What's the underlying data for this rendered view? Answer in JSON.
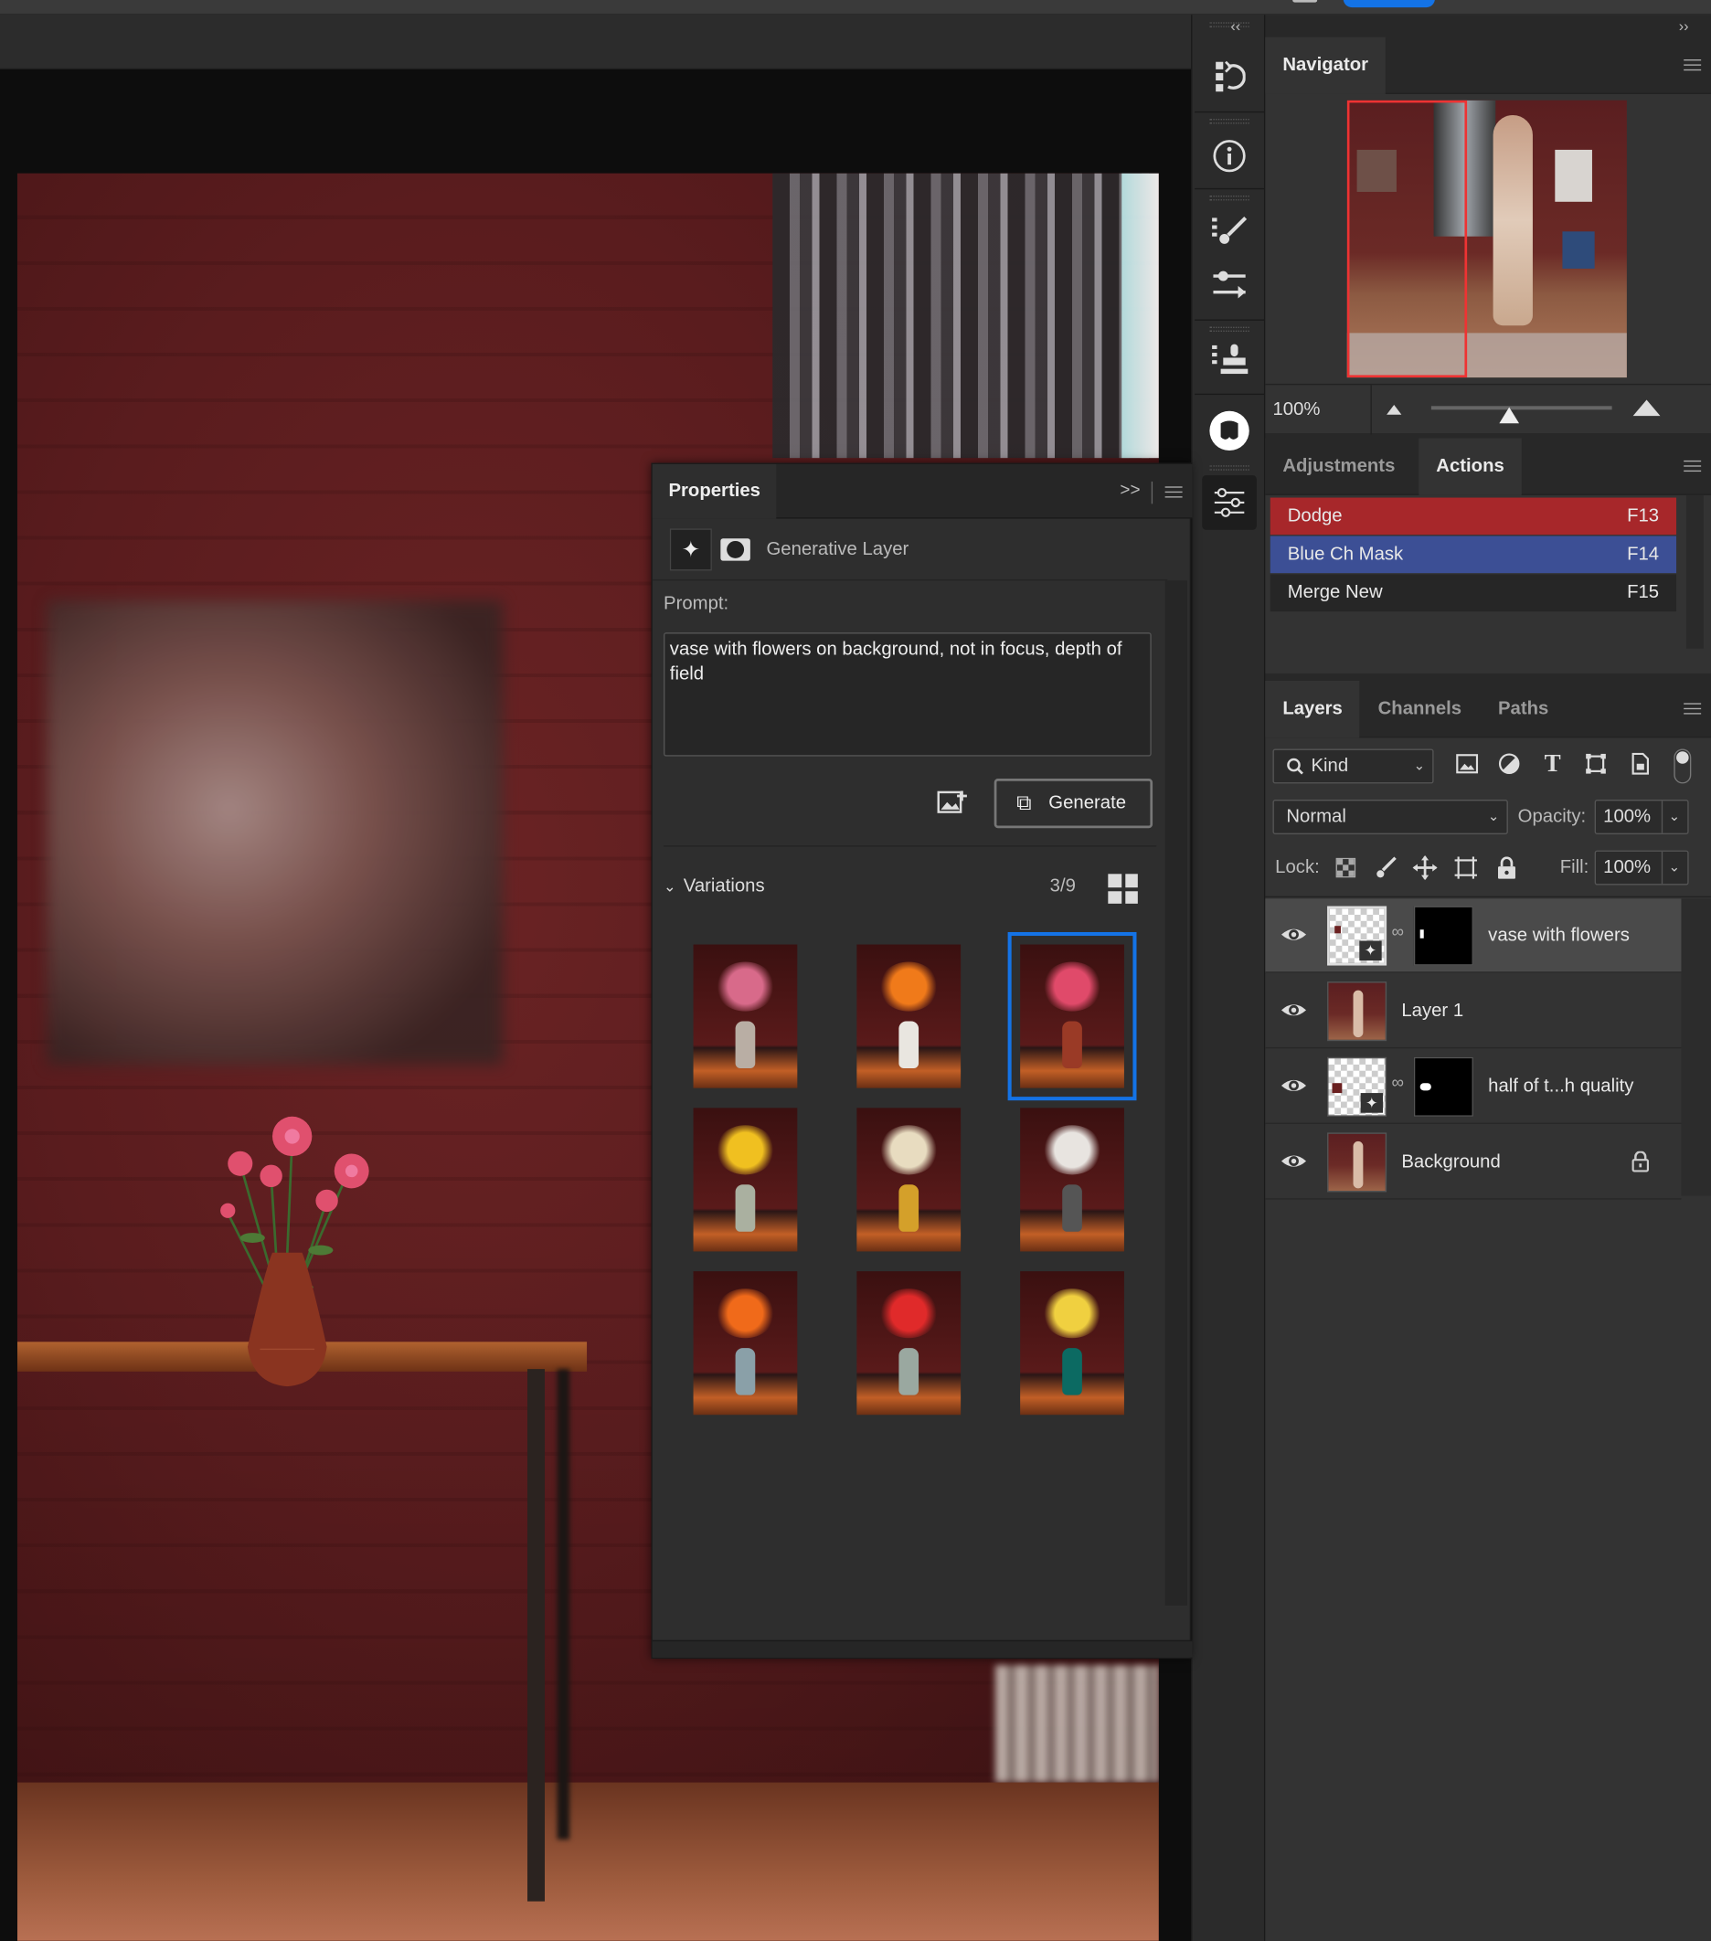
{
  "colors": {
    "accent": "#1473e6",
    "action_dodge": "#a7272a",
    "action_blue": "#3c4f95",
    "panel_bg": "#333333"
  },
  "icons": {
    "collapse_left": "‹‹",
    "collapse_right": "››",
    "toolstrip": [
      "history-icon",
      "info-icon",
      "brush-presets-icon",
      "adjust-presets-icon",
      "clone-source-icon",
      "libraries-icon",
      "adjustment-sliders-icon"
    ]
  },
  "navigator": {
    "title": "Navigator",
    "zoom": "100%",
    "zoom_slider_fraction": 0.43
  },
  "adjustments_panel": {
    "tabs": [
      "Adjustments",
      "Actions"
    ],
    "active_tab": "Actions",
    "actions": [
      {
        "name": "Dodge",
        "key": "F13",
        "color": "#a7272a"
      },
      {
        "name": "Blue Ch Mask",
        "key": "F14",
        "color": "#3c4f95"
      },
      {
        "name": "Merge New",
        "key": "F15",
        "color": "#262626"
      }
    ]
  },
  "layers_panel": {
    "tabs": [
      "Layers",
      "Channels",
      "Paths"
    ],
    "active_tab": "Layers",
    "filter_kind": "Kind",
    "blend_mode": "Normal",
    "opacity_label": "Opacity:",
    "opacity": "100%",
    "lock_label": "Lock:",
    "fill_label": "Fill:",
    "fill": "100%",
    "layers": [
      {
        "name": "vase with flowers",
        "selected": true,
        "has_mask": true,
        "locked": false
      },
      {
        "name": "Layer 1",
        "selected": false,
        "has_mask": false,
        "locked": false
      },
      {
        "name": "half of t...h quality",
        "selected": false,
        "has_mask": true,
        "locked": false
      },
      {
        "name": "Background",
        "selected": false,
        "has_mask": false,
        "locked": true
      }
    ]
  },
  "properties": {
    "title": "Properties",
    "layer_type": "Generative Layer",
    "prompt_label": "Prompt:",
    "prompt_value": "vase with flowers on background, not in focus, depth of field",
    "generate_label": "Generate",
    "variations_label": "Variations",
    "variation_count": "3/9",
    "selected_variation": 3,
    "variations": [
      {
        "vase": "#b9aea4",
        "flowers": "#d86a8a"
      },
      {
        "vase": "#e9e6e0",
        "flowers": "#f07a1a"
      },
      {
        "vase": "#9a3a26",
        "flowers": "#e04a6a"
      },
      {
        "vase": "#aab0a0",
        "flowers": "#f0c020"
      },
      {
        "vase": "#d4a02a",
        "flowers": "#e8dcc0"
      },
      {
        "vase": "#555555",
        "flowers": "#e8e4e0"
      },
      {
        "vase": "#8aa0a8",
        "flowers": "#f06a1a"
      },
      {
        "vase": "#9aa8a0",
        "flowers": "#e02a2a"
      },
      {
        "vase": "#0c6a62",
        "flowers": "#f0d040"
      }
    ]
  }
}
